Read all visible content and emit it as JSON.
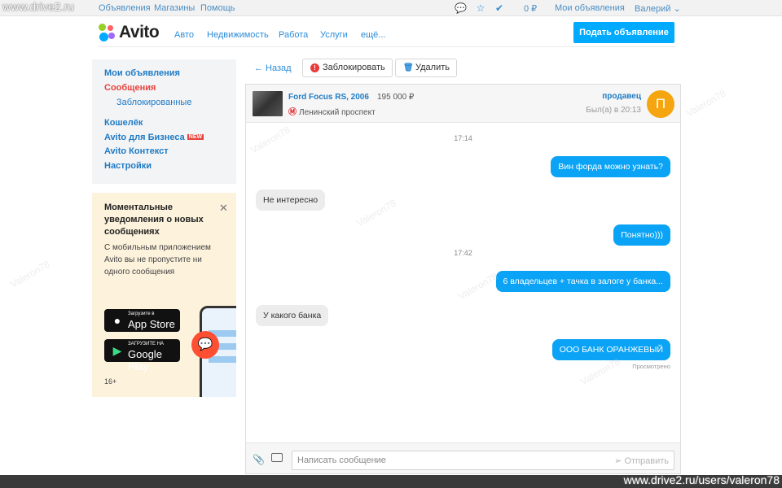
{
  "watermark": {
    "top": "www.drive2.ru",
    "bottom": "www.drive2.ru/users/valeron78",
    "diag": "Valeron78"
  },
  "topbar": {
    "links": [
      "Объявления",
      "Магазины",
      "Помощь"
    ],
    "balance": "0 ₽",
    "my_ads": "Мои объявления",
    "user": "Валерий"
  },
  "header": {
    "logo": "Avito",
    "nav": [
      "Авто",
      "Недвижимость",
      "Работа",
      "Услуги",
      "ещё..."
    ],
    "post_button": "Подать объявление"
  },
  "sidebar": {
    "items": [
      "Мои объявления",
      "Сообщения",
      "Заблокированные",
      "Кошелёк",
      "Avito для Бизнеса",
      "Avito Контекст",
      "Настройки"
    ],
    "new_badge": "NEW"
  },
  "promo": {
    "title": "Моментальные уведомления о новых сообщениях",
    "text": "С мобильным приложением Avito вы не пропустите ни одного сообщения",
    "appstore_small": "Загрузите в",
    "appstore_big": "App Store",
    "googleplay_small": "ЗАГРУЗИТЕ НА",
    "googleplay_big": "Google Play",
    "age": "16+"
  },
  "toolbar": {
    "back": "← Назад",
    "block": "Заблокировать",
    "delete": "Удалить"
  },
  "chat": {
    "car_title": "Ford Focus RS, 2006",
    "price": "195 000 ₽",
    "metro": "Ленинский проспект",
    "seller_label": "продавец",
    "last_seen": "Был(а) в 20:13",
    "avatar_letter": "П",
    "messages": [
      {
        "type": "time",
        "text": "17:14"
      },
      {
        "type": "out",
        "text": "Вин форда можно узнать?"
      },
      {
        "type": "in",
        "text": "Не интересно"
      },
      {
        "type": "out",
        "text": "Понятно)))"
      },
      {
        "type": "time",
        "text": "17:42"
      },
      {
        "type": "out",
        "text": "6 владельцев + тачка в залоге у банка..."
      },
      {
        "type": "in",
        "text": "У какого банка"
      },
      {
        "type": "out",
        "text": "ООО БАНК ОРАНЖЕВЫЙ"
      }
    ],
    "seen": "Просмотрено",
    "input_placeholder": "Написать сообщение",
    "send": "Отправить"
  },
  "colors": {
    "accent": "#00aaff",
    "link": "#1f7bc4",
    "out_bubble": "#0aa3f5",
    "in_bubble": "#ececec",
    "promo_bg": "#fdf2dc",
    "avatar": "#f5a510"
  }
}
